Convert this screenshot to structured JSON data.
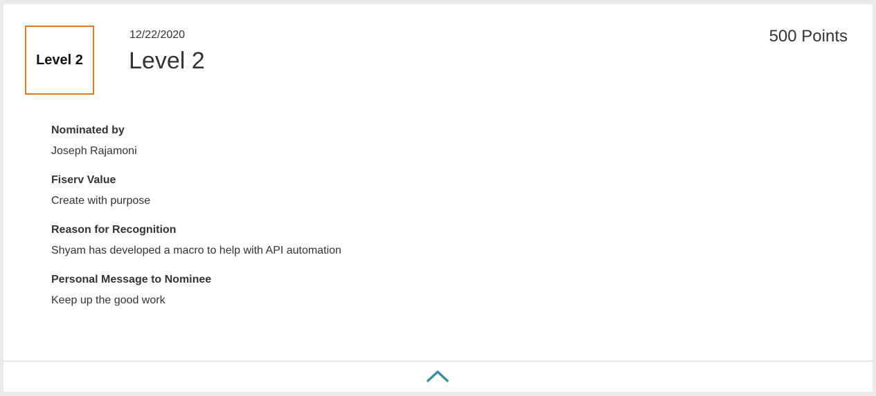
{
  "badge": {
    "label": "Level 2"
  },
  "header": {
    "date": "12/22/2020",
    "title": "Level 2",
    "points": "500 Points"
  },
  "details": [
    {
      "label": "Nominated by",
      "value": "Joseph Rajamoni"
    },
    {
      "label": "Fiserv Value",
      "value": "Create with purpose"
    },
    {
      "label": "Reason for Recognition",
      "value": "Shyam has developed a macro to help with API automation"
    },
    {
      "label": "Personal Message to Nominee",
      "value": "Keep up the good work"
    }
  ],
  "footer": {
    "collapse_icon": "chevron-up-icon"
  },
  "colors": {
    "badge_border": "#e87722",
    "chevron": "#3a8fa3",
    "text": "#333333"
  }
}
